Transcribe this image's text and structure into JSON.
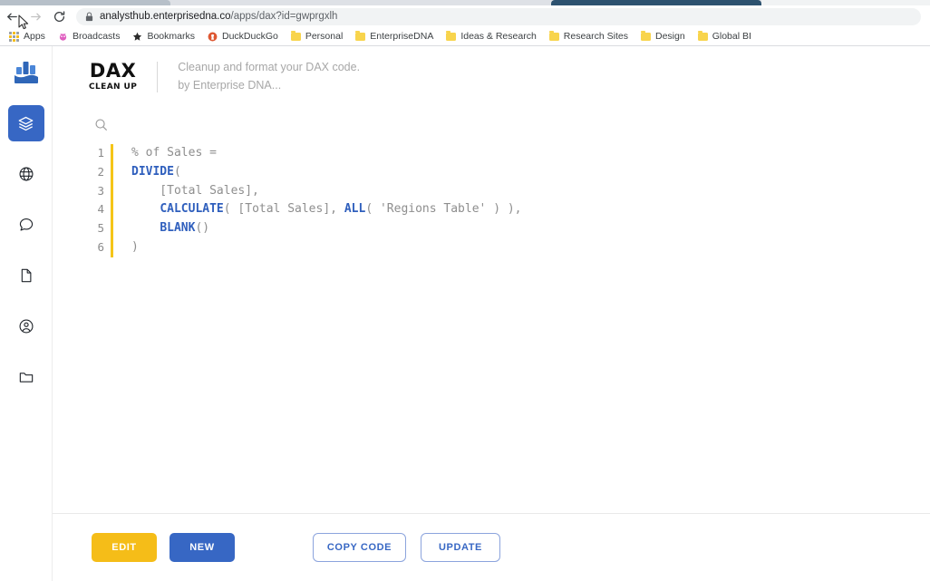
{
  "browser": {
    "nav": {
      "back_label": "Back",
      "forward_label": "Forward",
      "reload_label": "Reload"
    },
    "omnibox": {
      "lock_icon": "lock-icon",
      "url_domain": "analysthub.enterprisedna.co",
      "url_path": "/apps/dax?id=gwprgxlh",
      "full_url": "analysthub.enterprisedna.co/apps/dax?id=gwprgxlh"
    },
    "bookmarks": [
      {
        "label": "Apps",
        "icon": "apps-grid-icon"
      },
      {
        "label": "Broadcasts",
        "icon": "broadcast-icon"
      },
      {
        "label": "Bookmarks",
        "icon": "star-icon"
      },
      {
        "label": "DuckDuckGo",
        "icon": "duckduckgo-icon"
      },
      {
        "label": "Personal",
        "icon": "folder-icon"
      },
      {
        "label": "EnterpriseDNA",
        "icon": "folder-icon"
      },
      {
        "label": "Ideas & Research",
        "icon": "folder-icon"
      },
      {
        "label": "Research Sites",
        "icon": "folder-icon"
      },
      {
        "label": "Design",
        "icon": "folder-icon"
      },
      {
        "label": "Global BI",
        "icon": "folder-icon"
      }
    ]
  },
  "sidebar": {
    "logo_icon": "analytics-bars-logo",
    "items": [
      {
        "icon": "layers-icon",
        "name": "layers",
        "active": true
      },
      {
        "icon": "globe-icon",
        "name": "globe",
        "active": false
      },
      {
        "icon": "chat-icon",
        "name": "chat",
        "active": false
      },
      {
        "icon": "document-icon",
        "name": "document",
        "active": false
      },
      {
        "icon": "user-icon",
        "name": "user",
        "active": false
      },
      {
        "icon": "folder-icon",
        "name": "folder",
        "active": false
      }
    ]
  },
  "app": {
    "logo_title": "DAX",
    "logo_subtitle": "CLEAN UP",
    "tagline_line1": "Cleanup and format your DAX code.",
    "tagline_line2": "by Enterprise DNA..."
  },
  "editor": {
    "search_icon": "search-icon",
    "lines": [
      {
        "num": "1",
        "segments": [
          {
            "t": "% of Sales =",
            "k": "plain"
          }
        ]
      },
      {
        "num": "2",
        "segments": [
          {
            "t": "DIVIDE",
            "k": "fn"
          },
          {
            "t": "(",
            "k": "plain"
          }
        ]
      },
      {
        "num": "3",
        "segments": [
          {
            "t": "    [Total Sales],",
            "k": "plain"
          }
        ]
      },
      {
        "num": "4",
        "segments": [
          {
            "t": "    ",
            "k": "plain"
          },
          {
            "t": "CALCULATE",
            "k": "fn"
          },
          {
            "t": "( [Total Sales], ",
            "k": "plain"
          },
          {
            "t": "ALL",
            "k": "fn"
          },
          {
            "t": "( 'Regions Table' ) ),",
            "k": "plain"
          }
        ]
      },
      {
        "num": "5",
        "segments": [
          {
            "t": "    ",
            "k": "plain"
          },
          {
            "t": "BLANK",
            "k": "fn"
          },
          {
            "t": "()",
            "k": "plain"
          }
        ]
      },
      {
        "num": "6",
        "segments": [
          {
            "t": ")",
            "k": "plain"
          }
        ]
      }
    ],
    "raw_code": "% of Sales =\nDIVIDE(\n    [Total Sales],\n    CALCULATE( [Total Sales], ALL( 'Regions Table' ) ),\n    BLANK()\n)"
  },
  "footer": {
    "edit_label": "EDIT",
    "new_label": "NEW",
    "copy_label": "COPY CODE",
    "update_label": "UPDATE"
  },
  "colors": {
    "accent_blue": "#3767c4",
    "accent_yellow": "#f5bd18",
    "gutter_yellow": "#f5c518",
    "code_fn_blue": "#2f5fbd",
    "code_plain_gray": "#8e8e8e",
    "bookmark_folder": "#f8d44c"
  }
}
